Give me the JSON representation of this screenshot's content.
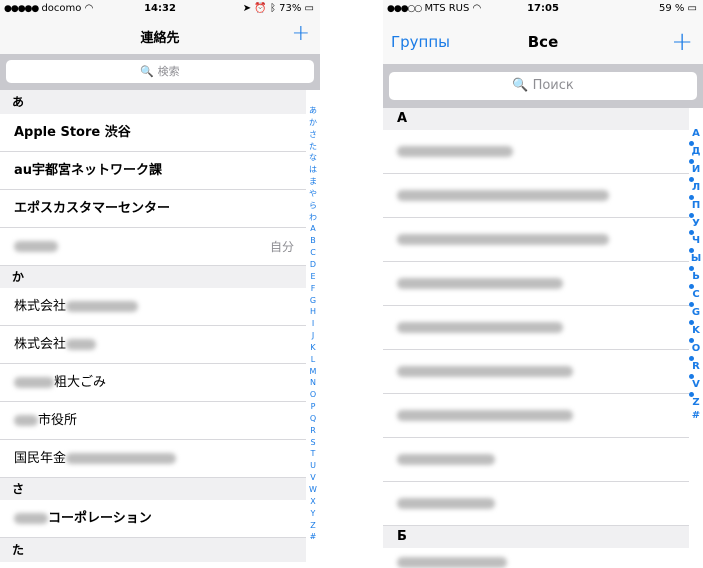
{
  "left": {
    "status": {
      "signal": "●●●●●",
      "carrier": "docomo",
      "time": "14:32",
      "battery": "73%"
    },
    "title": "連絡先",
    "add": "+",
    "search_placeholder": "🔍 検索",
    "sections": [
      "あ",
      "か",
      "さ",
      "た"
    ],
    "apple": "Apple  Store 渋谷",
    "au": "au宇都宮ネットワーク課",
    "epos": "エポスカスタマーセンター",
    "me": "自分",
    "kk1": "株式会社",
    "kk2": "株式会社",
    "sodai": "粗大ごみ",
    "shiyakusho": "市役所",
    "nenkin": "国民年金",
    "corp": "コーポレーション",
    "index": [
      "あ",
      "か",
      "さ",
      "た",
      "な",
      "は",
      "ま",
      "や",
      "ら",
      "わ",
      "A",
      "B",
      "C",
      "D",
      "E",
      "F",
      "G",
      "H",
      "I",
      "J",
      "K",
      "L",
      "M",
      "N",
      "O",
      "P",
      "Q",
      "R",
      "S",
      "T",
      "U",
      "V",
      "W",
      "X",
      "Y",
      "Z",
      "#"
    ]
  },
  "right": {
    "status": {
      "signal": "●●●○○",
      "carrier": "MTS RUS",
      "time": "17:05",
      "battery": "59 %"
    },
    "groups": "Группы",
    "title": "Все",
    "add": "+",
    "search_placeholder": "🔍 Поиск",
    "sections": [
      "А",
      "Б"
    ],
    "index": [
      "А",
      "•",
      "Д",
      "•",
      "И",
      "•",
      "Л",
      "•",
      "П",
      "•",
      "У",
      "•",
      "Ч",
      "•",
      "Ы",
      "•",
      "Ь",
      "•",
      "С",
      "•",
      "G",
      "•",
      "K",
      "•",
      "O",
      "•",
      "R",
      "•",
      "V",
      "•",
      "Z",
      "#"
    ]
  },
  "icons": {
    "wifi": "wifi-icon",
    "battery": "battery-icon",
    "search": "search-icon",
    "add": "plus-icon"
  },
  "colors": {
    "accent": "#1a7be6",
    "section_bg": "#f0f0f2",
    "search_bg": "#c9c9ce"
  }
}
